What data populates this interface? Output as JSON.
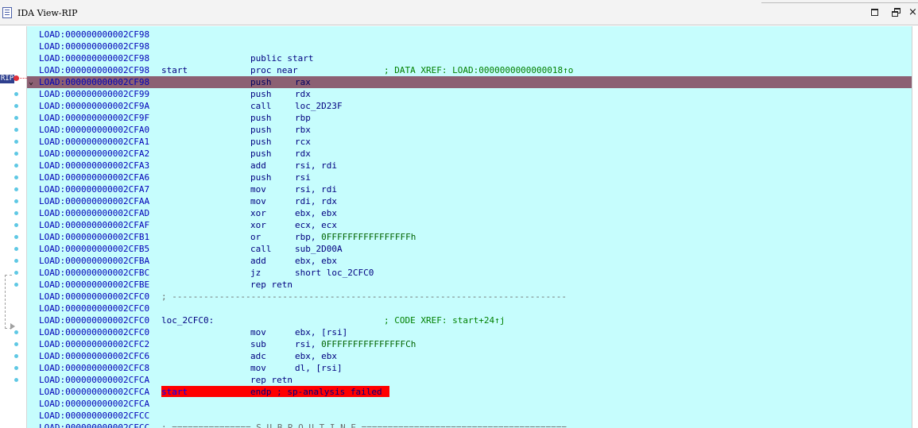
{
  "window": {
    "title": "IDA View-RIP",
    "close_glyph": "×"
  },
  "gutter": {
    "rip_label": "RIP"
  },
  "listing": [
    {
      "addr": "LOAD:000000000002CF98",
      "label": "",
      "mnem": "",
      "ops": "",
      "comment": ""
    },
    {
      "addr": "LOAD:000000000002CF98",
      "label": "",
      "mnem": "",
      "ops": "",
      "comment": ""
    },
    {
      "addr": "LOAD:000000000002CF98",
      "label": "",
      "mnem": "public start",
      "ops": "",
      "comment": ""
    },
    {
      "addr": "LOAD:000000000002CF98",
      "label": "start",
      "mnem": "proc near",
      "ops": "",
      "comment": "; DATA XREF: LOAD:0000000000000018↑o"
    },
    {
      "addr": "LOAD:000000000002CF98",
      "label": "",
      "mnem": "push",
      "ops": "rax",
      "comment": "",
      "current": true
    },
    {
      "addr": "LOAD:000000000002CF99",
      "label": "",
      "mnem": "push",
      "ops": "rdx",
      "comment": ""
    },
    {
      "addr": "LOAD:000000000002CF9A",
      "label": "",
      "mnem": "call",
      "ops": "loc_2D23F",
      "comment": ""
    },
    {
      "addr": "LOAD:000000000002CF9F",
      "label": "",
      "mnem": "push",
      "ops": "rbp",
      "comment": ""
    },
    {
      "addr": "LOAD:000000000002CFA0",
      "label": "",
      "mnem": "push",
      "ops": "rbx",
      "comment": ""
    },
    {
      "addr": "LOAD:000000000002CFA1",
      "label": "",
      "mnem": "push",
      "ops": "rcx",
      "comment": ""
    },
    {
      "addr": "LOAD:000000000002CFA2",
      "label": "",
      "mnem": "push",
      "ops": "rdx",
      "comment": ""
    },
    {
      "addr": "LOAD:000000000002CFA3",
      "label": "",
      "mnem": "add",
      "ops": "rsi, rdi",
      "comment": ""
    },
    {
      "addr": "LOAD:000000000002CFA6",
      "label": "",
      "mnem": "push",
      "ops": "rsi",
      "comment": ""
    },
    {
      "addr": "LOAD:000000000002CFA7",
      "label": "",
      "mnem": "mov",
      "ops": "rsi, rdi",
      "comment": ""
    },
    {
      "addr": "LOAD:000000000002CFAA",
      "label": "",
      "mnem": "mov",
      "ops": "rdi, rdx",
      "comment": ""
    },
    {
      "addr": "LOAD:000000000002CFAD",
      "label": "",
      "mnem": "xor",
      "ops": "ebx, ebx",
      "comment": ""
    },
    {
      "addr": "LOAD:000000000002CFAF",
      "label": "",
      "mnem": "xor",
      "ops": "ecx, ecx",
      "comment": ""
    },
    {
      "addr": "LOAD:000000000002CFB1",
      "label": "",
      "mnem": "or",
      "ops": "rbp, ",
      "opsnum": "0FFFFFFFFFFFFFFFFh",
      "comment": ""
    },
    {
      "addr": "LOAD:000000000002CFB5",
      "label": "",
      "mnem": "call",
      "ops": "sub_2D00A",
      "comment": ""
    },
    {
      "addr": "LOAD:000000000002CFBA",
      "label": "",
      "mnem": "add",
      "ops": "ebx, ebx",
      "comment": ""
    },
    {
      "addr": "LOAD:000000000002CFBC",
      "label": "",
      "mnem": "jz",
      "ops": "short loc_2CFC0",
      "comment": ""
    },
    {
      "addr": "LOAD:000000000002CFBE",
      "label": "",
      "mnem": "rep retn",
      "ops": "",
      "comment": ""
    },
    {
      "addr": "LOAD:000000000002CFC0",
      "separator": "; ---------------------------------------------------------------------------"
    },
    {
      "addr": "LOAD:000000000002CFC0",
      "label": "",
      "mnem": "",
      "ops": "",
      "comment": ""
    },
    {
      "addr": "LOAD:000000000002CFC0",
      "label": "loc_2CFC0:",
      "mnem": "",
      "ops": "",
      "comment": "; CODE XREF: start+24↑j"
    },
    {
      "addr": "LOAD:000000000002CFC0",
      "label": "",
      "mnem": "mov",
      "ops": "ebx, [rsi]",
      "comment": ""
    },
    {
      "addr": "LOAD:000000000002CFC2",
      "label": "",
      "mnem": "sub",
      "ops": "rsi, ",
      "opsnum": "0FFFFFFFFFFFFFFFCh",
      "comment": ""
    },
    {
      "addr": "LOAD:000000000002CFC6",
      "label": "",
      "mnem": "adc",
      "ops": "ebx, ebx",
      "comment": ""
    },
    {
      "addr": "LOAD:000000000002CFC8",
      "label": "",
      "mnem": "mov",
      "ops": "dl, [rsi]",
      "comment": ""
    },
    {
      "addr": "LOAD:000000000002CFCA",
      "label": "",
      "mnem": "rep retn",
      "ops": "",
      "comment": ""
    },
    {
      "addr": "LOAD:000000000002CFCA",
      "label": "start",
      "mnem": "endp ; sp-analysis failed",
      "ops": "",
      "comment": "",
      "error": true
    },
    {
      "addr": "LOAD:000000000002CFCA",
      "label": "",
      "mnem": "",
      "ops": "",
      "comment": ""
    },
    {
      "addr": "LOAD:000000000002CFCC",
      "label": "",
      "mnem": "",
      "ops": "",
      "comment": ""
    },
    {
      "addr": "LOAD:000000000002CFCC",
      "separator": "; =============== S U B R O U T I N E ======================================="
    }
  ],
  "colors": {
    "code_bg": "#c6fdfd",
    "current_line": "#8c6073",
    "error_highlight": "#ff0000",
    "address": "#0000b8",
    "comment": "#008000"
  }
}
